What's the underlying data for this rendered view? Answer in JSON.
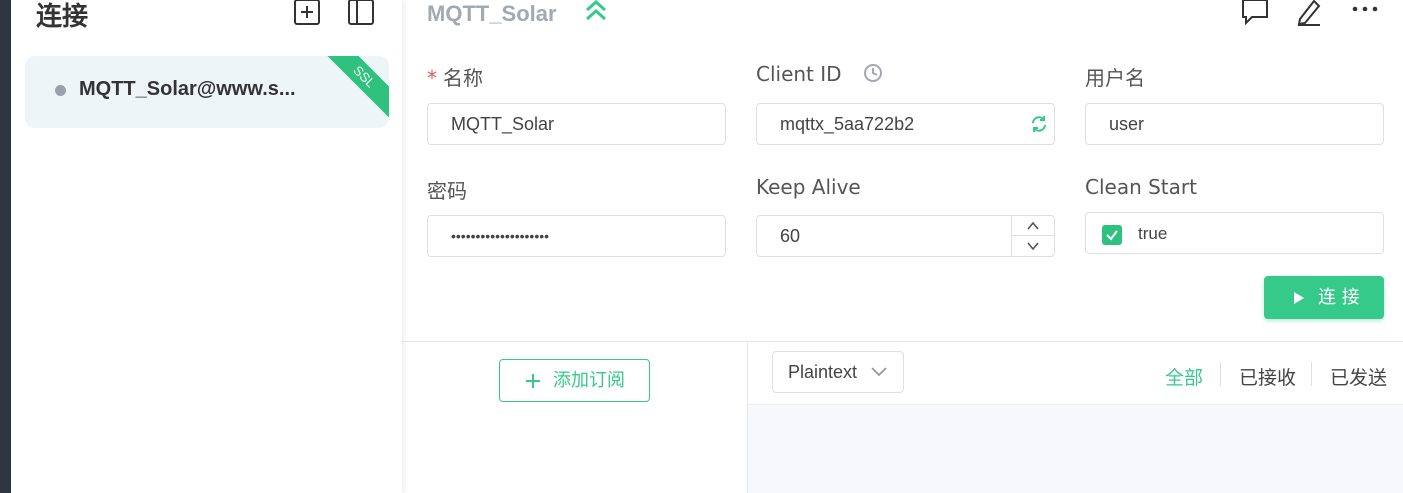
{
  "sidebar": {
    "title": "连接",
    "add_icon": "plus-square-icon",
    "layout_icon": "sidebar-layout-icon",
    "connections": [
      {
        "name": "MQTT_Solar@www.s...",
        "status": "disconnected",
        "badge": "SSL"
      }
    ]
  },
  "header": {
    "title": "MQTT_Solar",
    "collapse_icon": "double-chevron-up-icon",
    "icons": [
      "comment-icon",
      "edit-icon",
      "more-icon"
    ]
  },
  "form": {
    "name": {
      "label": "名称",
      "required_mark": "*",
      "value": "MQTT_Solar"
    },
    "client_id": {
      "label": "Client ID",
      "value": "mqttx_5aa722b2"
    },
    "username": {
      "label": "用户名",
      "value": "user"
    },
    "password": {
      "label": "密码",
      "value": "••••••••••••••••••••"
    },
    "keep_alive": {
      "label": "Keep Alive",
      "value": "60"
    },
    "clean_start": {
      "label": "Clean Start",
      "value": "true",
      "checked": true
    }
  },
  "connect_button": {
    "label": "连 接"
  },
  "subscriptions": {
    "add_label": "添加订阅"
  },
  "messages": {
    "format": "Plaintext",
    "filters": [
      "全部",
      "已接收",
      "已发送"
    ],
    "active_filter": "全部"
  },
  "colors": {
    "accent": "#35c98a",
    "ssl_badge": "#2fc27e",
    "rail": "#2f3541",
    "required": "#e4584f"
  }
}
